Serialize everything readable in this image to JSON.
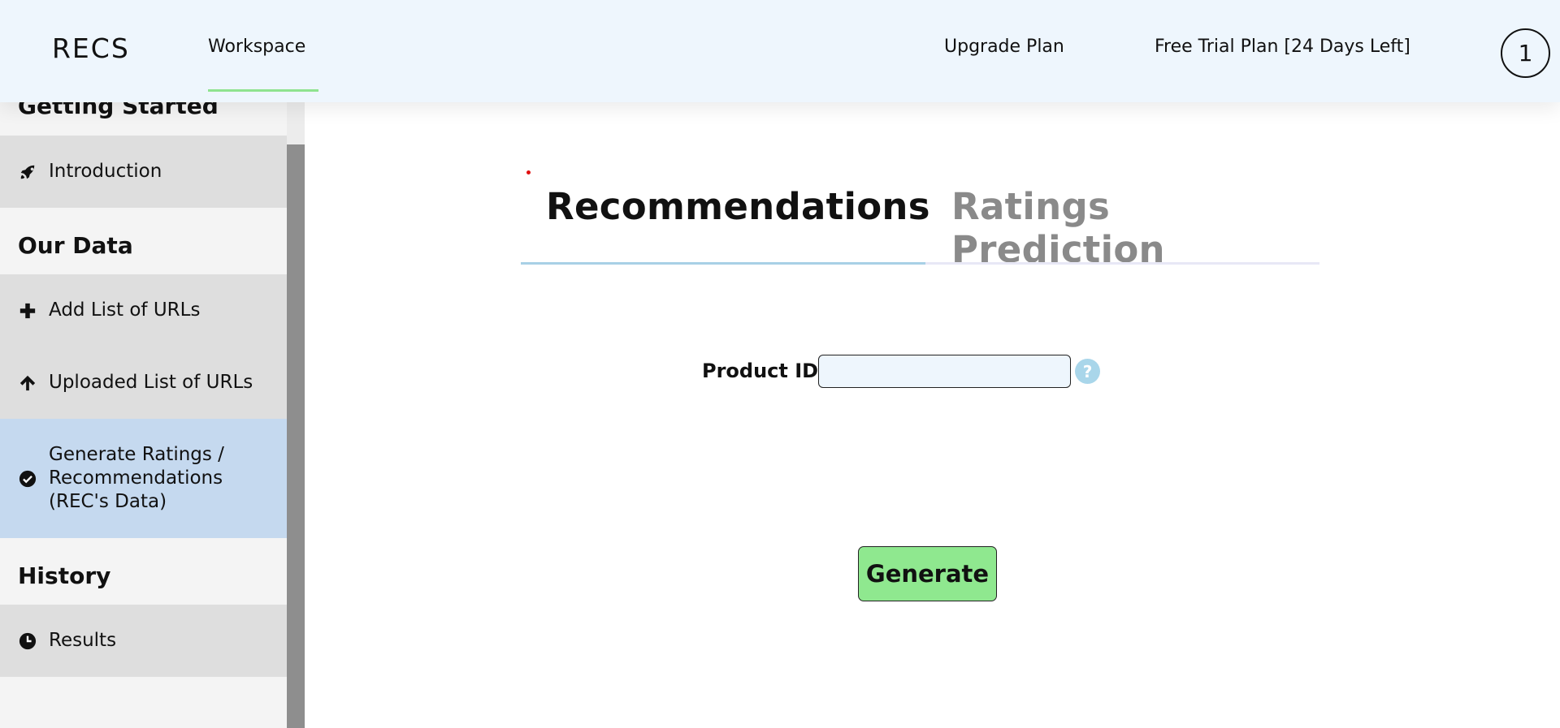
{
  "header": {
    "logo": "RECS",
    "nav": [
      {
        "label": "Workspace"
      },
      {
        "label": "Upgrade Plan"
      },
      {
        "label": "Free Trial Plan [24 Days Left]"
      }
    ],
    "avatar": "1",
    "active_nav": "Workspace"
  },
  "sidebar": {
    "sections": [
      {
        "title": "Getting Started",
        "items": [
          {
            "label": "Introduction",
            "icon": "rocket-icon"
          }
        ]
      },
      {
        "title": "Our Data",
        "items": [
          {
            "label": "Add List of URLs",
            "icon": "plus-icon"
          },
          {
            "label": "Uploaded List of URLs",
            "icon": "arrow-up-icon"
          },
          {
            "label": "Generate Ratings / Recommendations (REC's Data)",
            "icon": "check-circle-icon",
            "active": true
          }
        ]
      },
      {
        "title": "History",
        "items": [
          {
            "label": "Results",
            "icon": "clock-icon"
          }
        ]
      }
    ]
  },
  "main": {
    "tabs": [
      {
        "label": "Recommendations",
        "active": true
      },
      {
        "label": "Ratings Prediction",
        "active": false
      }
    ],
    "product_id": {
      "label": "Product ID:",
      "value": "",
      "placeholder": ""
    },
    "help_icon": "?",
    "generate_label": "Generate"
  },
  "colors": {
    "header_bg": "#eef6fd",
    "active_sidebar_bg": "#c5d9ef",
    "generate_bg": "#8fe88f",
    "nav_underline": "#8fe38f",
    "tab_active_line": "#a8d0e6"
  }
}
